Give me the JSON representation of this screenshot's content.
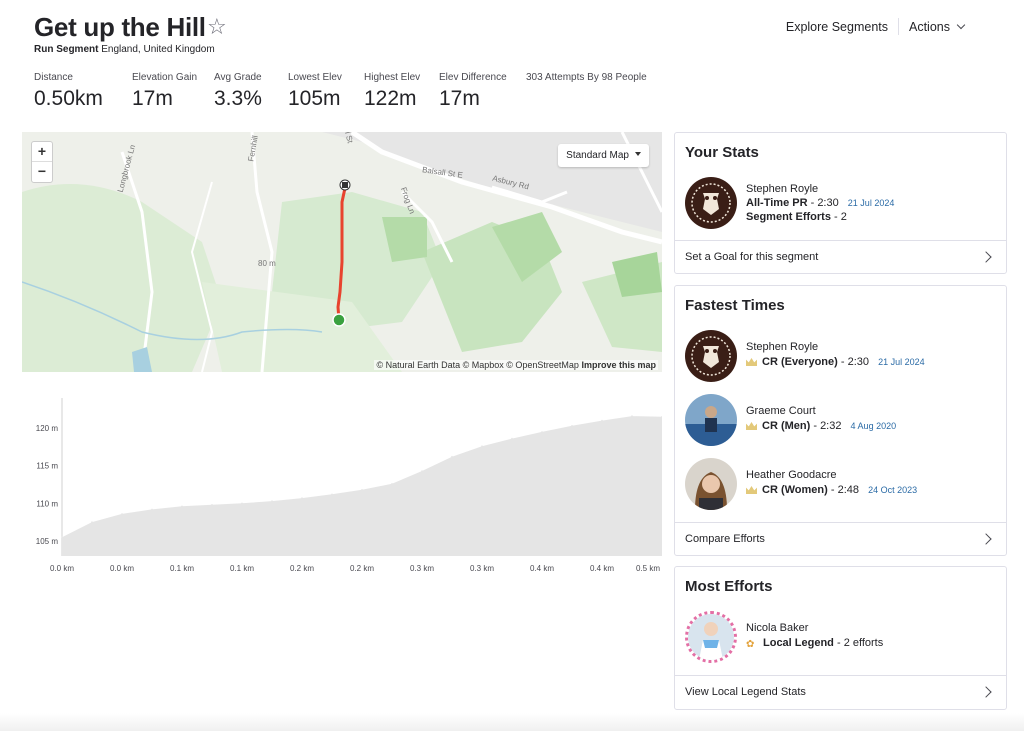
{
  "header": {
    "title": "Get up the Hill",
    "star_icon": "☆",
    "segment_type": "Run Segment",
    "location": "England, United Kingdom",
    "nav": {
      "explore": "Explore Segments",
      "actions": "Actions"
    }
  },
  "stats": [
    {
      "label": "Distance",
      "value": "0.50km"
    },
    {
      "label": "Elevation Gain",
      "value": "17m"
    },
    {
      "label": "Avg Grade",
      "value": "3.3%"
    },
    {
      "label": "Lowest Elev",
      "value": "105m"
    },
    {
      "label": "Highest Elev",
      "value": "122m"
    },
    {
      "label": "Elev Difference",
      "value": "17m"
    },
    {
      "label": "303 Attempts By 98 People",
      "value": ""
    }
  ],
  "map": {
    "zoom_in": "+",
    "zoom_out": "−",
    "map_type": "Standard Map",
    "attribution": "© Natural Earth Data © Mapbox © OpenStreetMap",
    "improve": "Improve this map",
    "streets": {
      "balsall": "Balsall St E",
      "asbury": "Asbury Rd",
      "frog": "Frog Ln",
      "fernhill": "Fernhill",
      "longbrook": "Longbrook Ln",
      "ball": "ll St",
      "contour": "80 m"
    }
  },
  "chart_data": {
    "type": "area",
    "title": "",
    "xlabel": "",
    "ylabel": "",
    "y_tick_labels": [
      "105 m",
      "110 m",
      "115 m",
      "120 m"
    ],
    "y_ticks": [
      105,
      110,
      115,
      120
    ],
    "ylim": [
      103,
      124
    ],
    "x_tick_labels": [
      "0.0 km",
      "0.0 km",
      "0.1 km",
      "0.1 km",
      "0.2 km",
      "0.2 km",
      "0.3 km",
      "0.3 km",
      "0.4 km",
      "0.4 km",
      "0.5 km"
    ],
    "xlim": [
      0,
      0.5
    ],
    "x": [
      0,
      0.025,
      0.05,
      0.075,
      0.1,
      0.125,
      0.15,
      0.175,
      0.2,
      0.225,
      0.25,
      0.275,
      0.3,
      0.325,
      0.35,
      0.375,
      0.4,
      0.425,
      0.45,
      0.475,
      0.5
    ],
    "y": [
      105.5,
      107.5,
      108.6,
      109.2,
      109.6,
      109.8,
      110.0,
      110.3,
      110.7,
      111.2,
      111.8,
      112.6,
      114.3,
      116.2,
      117.6,
      118.6,
      119.5,
      120.3,
      121.0,
      121.6,
      121.5
    ],
    "fill_color": "#e5e5e5",
    "grid": false
  },
  "your_stats": {
    "title": "Your Stats",
    "name": "Stephen Royle",
    "pr_label": "All-Time PR",
    "pr_value": "- 2:30",
    "pr_date": "21 Jul 2024",
    "efforts_label": "Segment Efforts",
    "efforts_value": "- 2",
    "goal_link": "Set a Goal for this segment"
  },
  "fastest": {
    "title": "Fastest Times",
    "entries": [
      {
        "name": "Stephen Royle",
        "label": "CR (Everyone)",
        "time": "- 2:30",
        "date": "21 Jul 2024"
      },
      {
        "name": "Graeme Court",
        "label": "CR (Men)",
        "time": "- 2:32",
        "date": "4 Aug 2020"
      },
      {
        "name": "Heather Goodacre",
        "label": "CR (Women)",
        "time": "- 2:48",
        "date": "24 Oct 2023"
      }
    ],
    "compare_link": "Compare Efforts"
  },
  "most_efforts": {
    "title": "Most Efforts",
    "name": "Nicola Baker",
    "label": "Local Legend",
    "count": "- 2 efforts",
    "link": "View Local Legend Stats"
  },
  "colors": {
    "route": "#e8432e",
    "start": "#3aa13f",
    "link_date": "#2b6ba6",
    "crown": "#e3c97a"
  }
}
